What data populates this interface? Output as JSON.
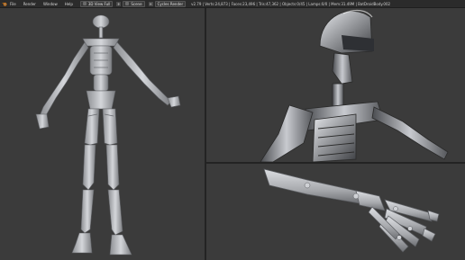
{
  "menu": {
    "items": [
      "File",
      "Render",
      "Window",
      "Help"
    ]
  },
  "header": {
    "layout_value": "3D View Full",
    "scene_value": "Scene",
    "engine_value": "Cycles Render",
    "stats": "v2.79 | Verts:24,873 | Faces:23,496 | Tris:47,362 | Objects:0/45 | Lamps:0/0 | Mem:31.49M | BatDroidBody.002"
  },
  "colors": {
    "viewport_bg": "#3b3b3b",
    "header_bg": "#2b2b2b"
  }
}
